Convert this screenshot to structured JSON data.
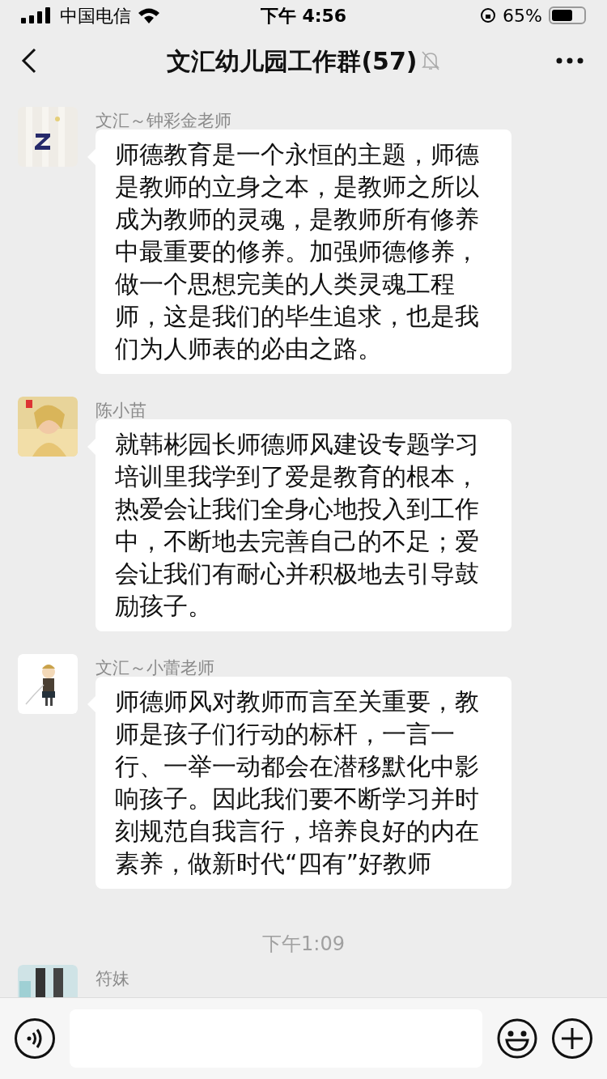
{
  "status_bar": {
    "carrier": "中国电信",
    "time": "下午 4:56",
    "battery": "65%"
  },
  "nav": {
    "title": "文汇幼儿园工作群(57)",
    "muted": true
  },
  "messages": [
    {
      "kind": "message",
      "sender": "文汇～钟彩金老师",
      "text": "师德教育是一个永恒的主题，师德是教师的立身之本，是教师之所以成为教师的灵魂，是教师所有修养中最重要的修养。加强师德修养，做一个思想完美的人类灵魂工程师，这是我们的毕生追求，也是我们为人师表的必由之路。"
    },
    {
      "kind": "message",
      "sender": "陈小苗",
      "text": "就韩彬园长师德师风建设专题学习培训里我学到了爱是教育的根本，热爱会让我们全身心地投入到工作中，不断地去完善自己的不足；爱会让我们有耐心并积极地去引导鼓励孩子。"
    },
    {
      "kind": "message",
      "sender": "文汇～小蕾老师",
      "text": "师德师风对教师而言至关重要，教师是孩子们行动的标杆，一言一行、一举一动都会在潜移默化中影响孩子。因此我们要不断学习并时刻规范自我言行，培养良好的内在素养，做新时代“四有”好教师"
    },
    {
      "kind": "time",
      "text": "下午1:09"
    },
    {
      "kind": "message",
      "sender": "符妹"
    }
  ]
}
